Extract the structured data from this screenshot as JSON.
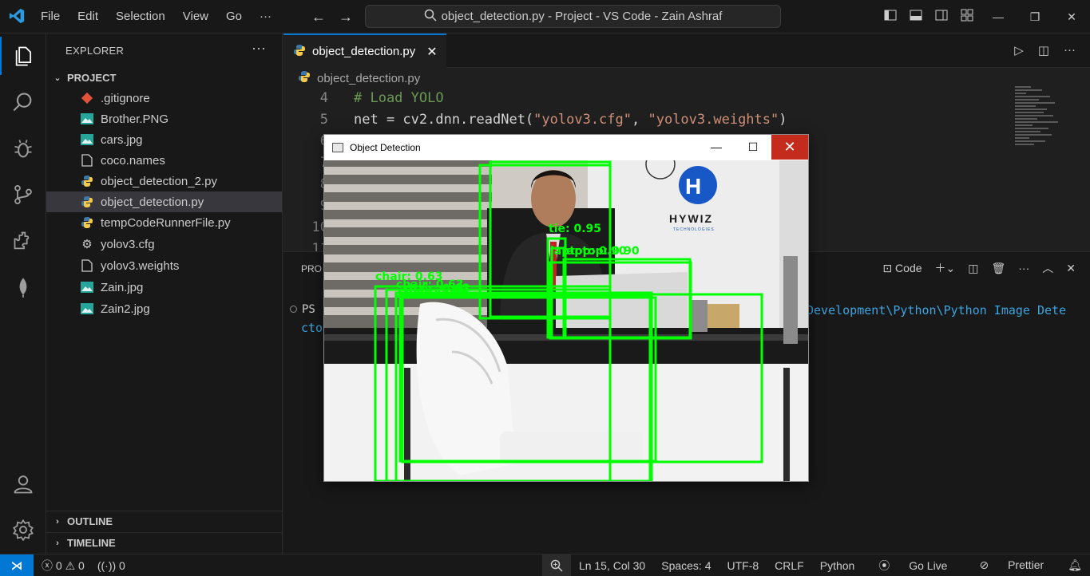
{
  "titlebar": {
    "menu": [
      "File",
      "Edit",
      "Selection",
      "View",
      "Go",
      "···"
    ],
    "search": "object_detection.py - Project - VS Code - Zain Ashraf"
  },
  "sidebar": {
    "title": "EXPLORER",
    "more": "···",
    "project": "PROJECT",
    "files": [
      {
        "name": ".gitignore",
        "icon": "git-icon"
      },
      {
        "name": "Brother.PNG",
        "icon": "image-icon"
      },
      {
        "name": "cars.jpg",
        "icon": "image-icon"
      },
      {
        "name": "coco.names",
        "icon": "file-icon"
      },
      {
        "name": "object_detection_2.py",
        "icon": "python-icon"
      },
      {
        "name": "object_detection.py",
        "icon": "python-icon"
      },
      {
        "name": "tempCodeRunnerFile.py",
        "icon": "python-icon"
      },
      {
        "name": "yolov3.cfg",
        "icon": "gear-icon"
      },
      {
        "name": "yolov3.weights",
        "icon": "file-icon"
      },
      {
        "name": "Zain.jpg",
        "icon": "image-icon"
      },
      {
        "name": "Zain2.jpg",
        "icon": "image-icon"
      }
    ],
    "outline": "OUTLINE",
    "timeline": "TIMELINE"
  },
  "editor": {
    "tab_label": "object_detection.py",
    "breadcrumb": "object_detection.py",
    "lines": [
      {
        "num": "4",
        "text": "# Load YOLO"
      },
      {
        "num": "5",
        "prefix": "net = cv2.dnn.readNet(",
        "s1": "\"yolov3.cfg\"",
        "mid": ", ",
        "s2": "\"yolov3.weights\"",
        "suffix": ")"
      }
    ],
    "hidden_line_nums": [
      "7",
      "8",
      "9",
      "10",
      "11"
    ]
  },
  "panel": {
    "tab": "PRO",
    "code_label": "Code",
    "prompt": "PS",
    "path_tail": "Development\\Python\\Python Image Dete",
    "path_cont": "cto"
  },
  "window": {
    "title": "Object Detection",
    "labels": [
      "chair: 0.63",
      "tie: 0.95",
      "laptop: 0.90",
      "person: 0.99"
    ]
  },
  "status": {
    "errors": "0",
    "warnings": "0",
    "ports": "0",
    "position": "Ln 15, Col 30",
    "spaces": "Spaces: 4",
    "encoding": "UTF-8",
    "eol": "CRLF",
    "language": "Python",
    "golive": "Go Live",
    "prettier": "Prettier"
  },
  "colors": {
    "accent": "#0078d4",
    "box": "#00ff00",
    "close_red": "#c42b1c"
  }
}
